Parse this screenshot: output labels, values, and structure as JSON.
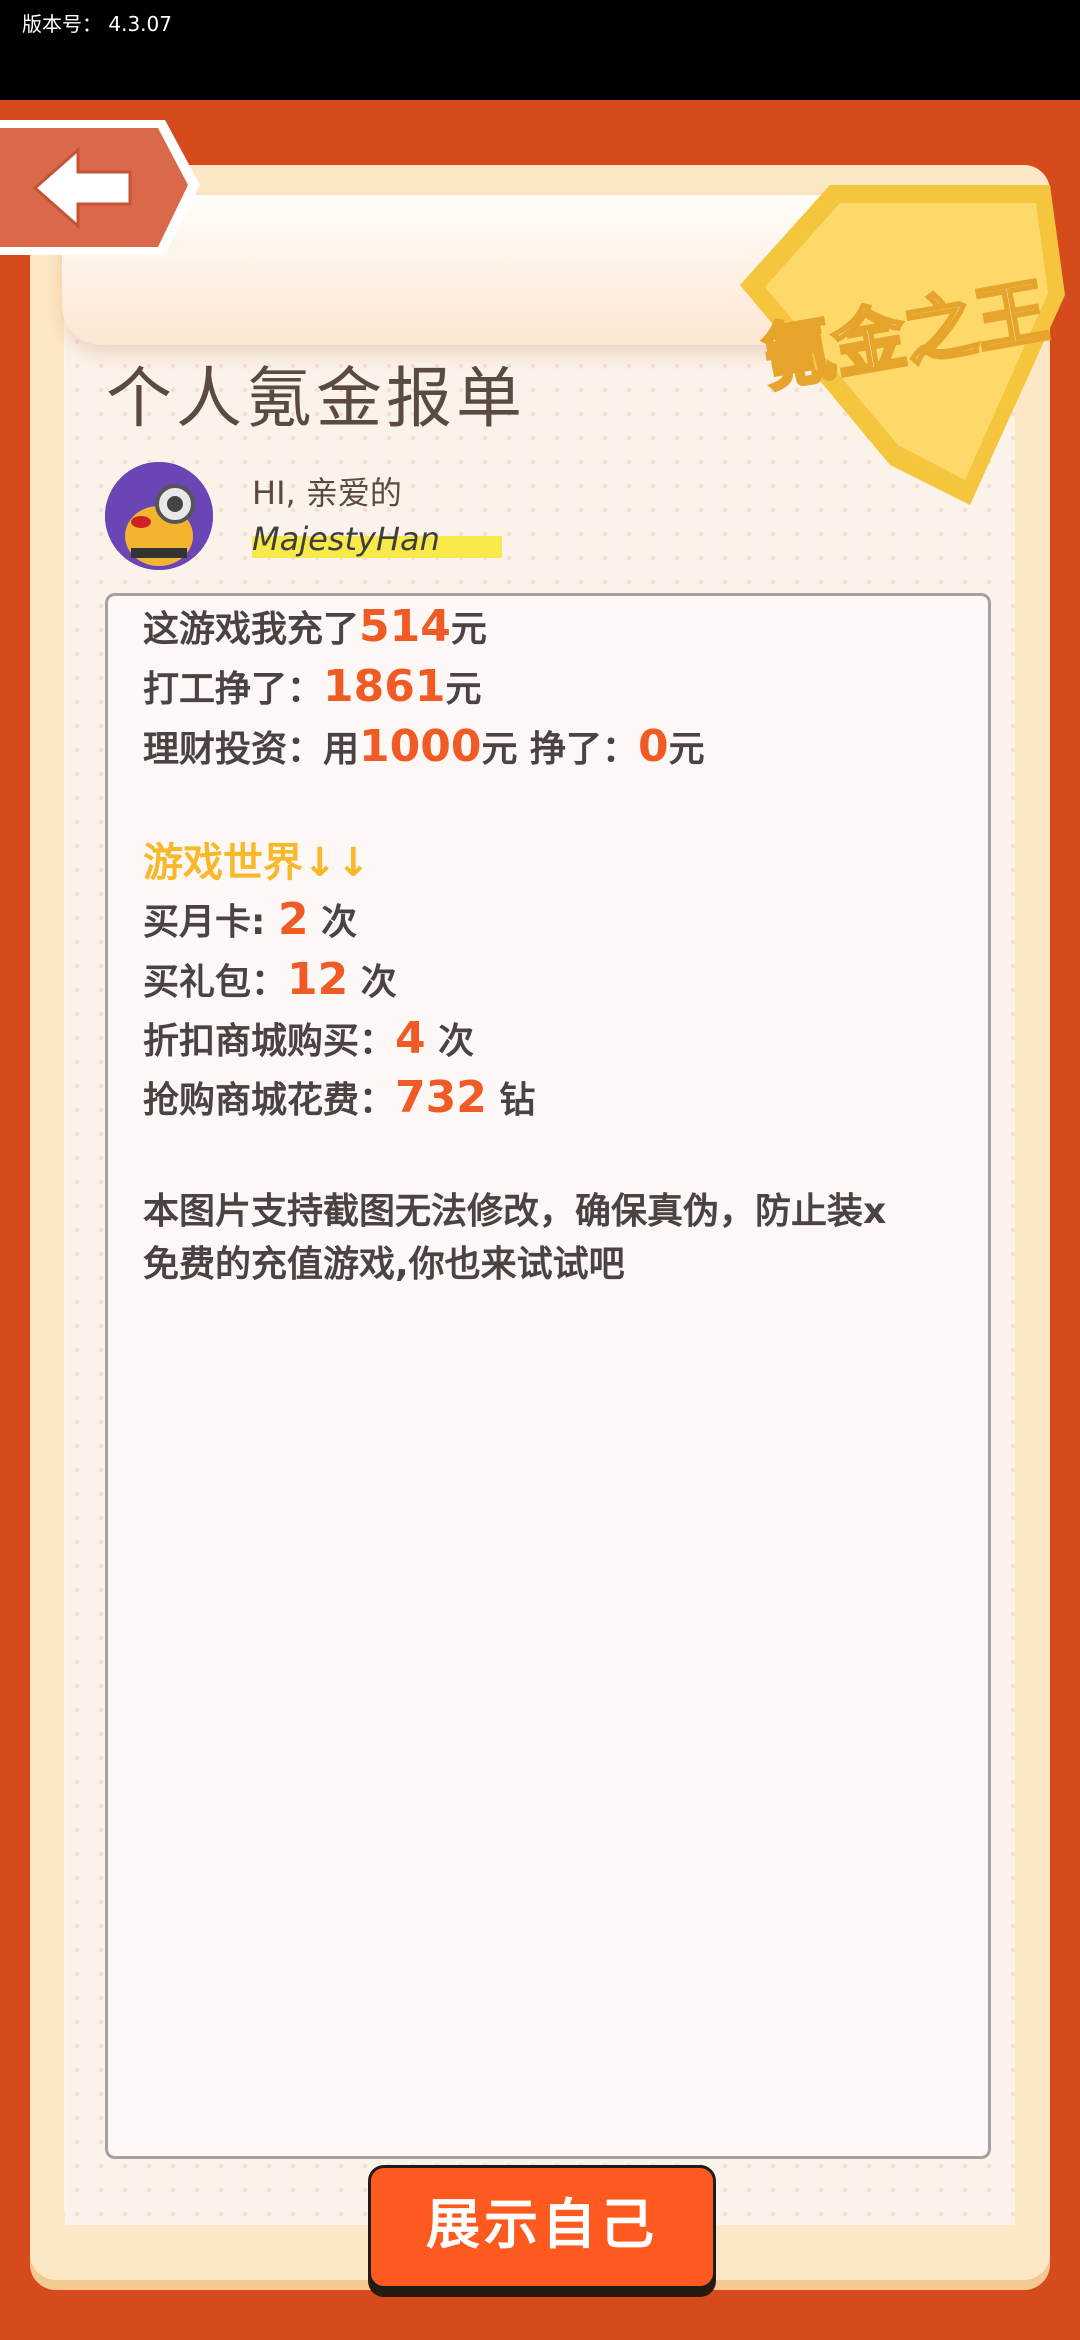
{
  "status": {
    "version_label": "版本号：",
    "version_value": "4.3.07"
  },
  "header": {
    "title": "个人氪金报单",
    "badge_text": "氪金之王"
  },
  "user": {
    "greeting": "HI, 亲爱的",
    "name": "MajestyHan"
  },
  "report": {
    "line1": {
      "prefix": "这游戏我充了",
      "value": "514",
      "suffix": "元"
    },
    "line2": {
      "prefix": "打工挣了：",
      "value": "1861",
      "suffix": "元"
    },
    "line3": {
      "prefix": "理财投资：用",
      "value1": "1000",
      "mid": "元  挣了：",
      "value2": "0",
      "suffix": "元"
    },
    "section_title": "游戏世界↓↓",
    "monthly_card": {
      "prefix": "买月卡: ",
      "value": "2",
      "suffix": " 次"
    },
    "gift_pack": {
      "prefix": "买礼包：",
      "value": "12",
      "suffix": " 次"
    },
    "discount_shop": {
      "prefix": "折扣商城购买：",
      "value": "4",
      "suffix": " 次"
    },
    "flash_shop": {
      "prefix": "抢购商城花费：",
      "value": "732",
      "suffix": " 钻"
    },
    "note_line1": "本图片支持截图无法修改，确保真伪，防止装x",
    "note_line2": "免费的充值游戏,你也来试试吧"
  },
  "actions": {
    "show_button": "展示自己"
  },
  "colors": {
    "frame": "#d54b1c",
    "accent": "#f05a24",
    "section": "#f7b92b",
    "button": "#fe5a1f"
  }
}
